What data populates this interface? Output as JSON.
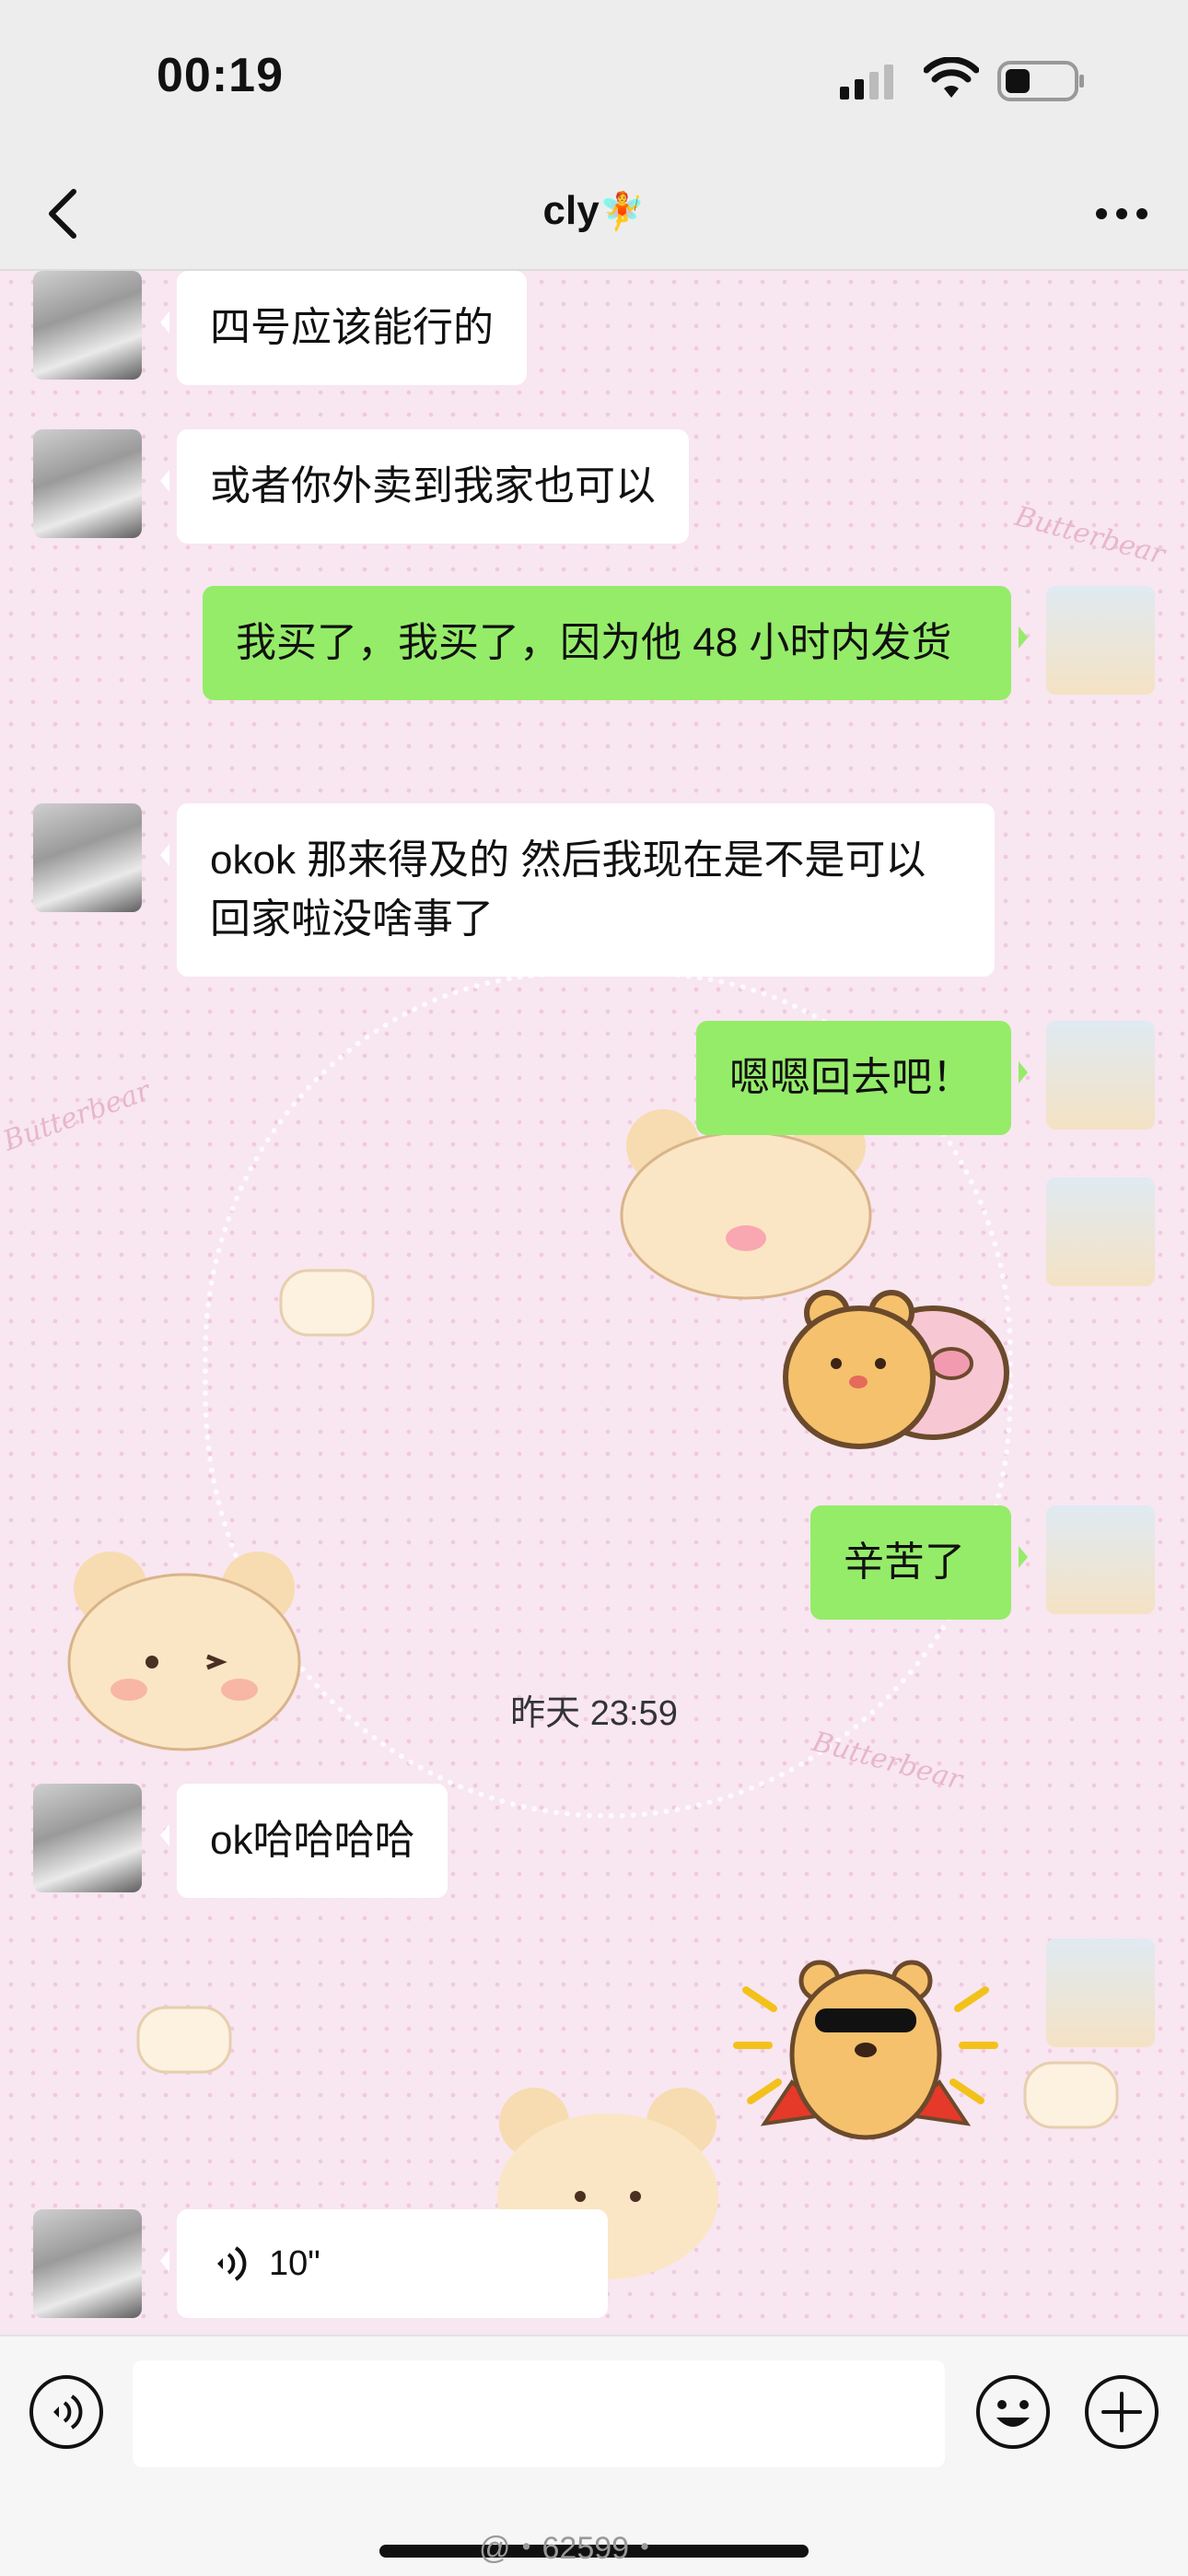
{
  "status_bar": {
    "time": "00:19"
  },
  "nav": {
    "title": "cly",
    "title_emoji": "🧚",
    "back_icon": "chevron-left-icon",
    "more_icon": "ellipsis-icon"
  },
  "background": {
    "brand_text_1": "Butterbear",
    "brand_text_2": "Butterbear",
    "brand_text_3": "Butterbear"
  },
  "messages": [
    {
      "side": "left",
      "text": "四号应该能行的"
    },
    {
      "side": "left",
      "text": "或者你外卖到我家也可以"
    },
    {
      "side": "right",
      "text": "我买了，我买了，因为他 48 小时内发货"
    },
    {
      "side": "left",
      "text": "okok 那来得及的 然后我现在是不是可以回家啦没啥事了"
    },
    {
      "side": "right",
      "text": "嗯嗯回去吧！"
    },
    {
      "side": "right",
      "type": "sticker",
      "sticker": "bear-hugging-pig-sticker"
    },
    {
      "side": "right",
      "text": "辛苦了"
    },
    {
      "type": "timestamp",
      "text": "昨天 23:59"
    },
    {
      "side": "left",
      "text": "ok哈哈哈哈"
    },
    {
      "side": "right",
      "type": "sticker",
      "sticker": "bear-sunglasses-cape-sticker"
    },
    {
      "side": "left",
      "type": "voice",
      "duration": "10\""
    }
  ],
  "input_bar": {
    "placeholder": "",
    "voice_icon": "voice-wave-icon",
    "emoji_icon": "smiley-icon",
    "plus_icon": "plus-circle-icon"
  },
  "watermark": "@・62599・",
  "colors": {
    "bubble_sent": "#95ec69",
    "bubble_received": "#ffffff",
    "bar_bg": "#ededed"
  }
}
